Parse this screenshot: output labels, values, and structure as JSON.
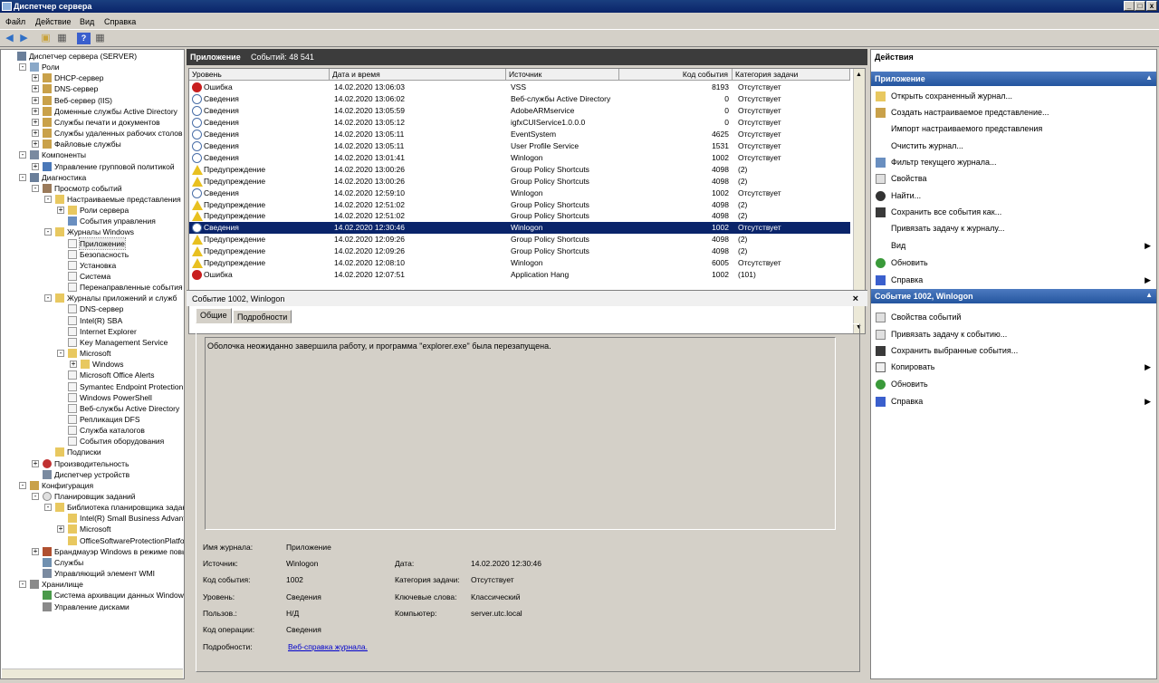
{
  "window": {
    "title": "Диспетчер сервера"
  },
  "menu": [
    "Файл",
    "Действие",
    "Вид",
    "Справка"
  ],
  "tree": [
    {
      "label": "Диспетчер сервера (SERVER)",
      "level": 0,
      "exp": "",
      "icon": "server-icon"
    },
    {
      "label": "Роли",
      "level": 1,
      "exp": "-",
      "icon": "roles-icon"
    },
    {
      "label": "DHCP-сервер",
      "level": 2,
      "exp": "+",
      "icon": "role-icon"
    },
    {
      "label": "DNS-сервер",
      "level": 2,
      "exp": "+",
      "icon": "role-icon"
    },
    {
      "label": "Веб-сервер (IIS)",
      "level": 2,
      "exp": "+",
      "icon": "role-icon"
    },
    {
      "label": "Доменные службы Active Directory",
      "level": 2,
      "exp": "+",
      "icon": "role-icon"
    },
    {
      "label": "Службы печати и документов",
      "level": 2,
      "exp": "+",
      "icon": "role-icon"
    },
    {
      "label": "Службы удаленных рабочих столов",
      "level": 2,
      "exp": "+",
      "icon": "role-icon"
    },
    {
      "label": "Файловые службы",
      "level": 2,
      "exp": "+",
      "icon": "role-icon"
    },
    {
      "label": "Компоненты",
      "level": 1,
      "exp": "-",
      "icon": "features-icon"
    },
    {
      "label": "Управление групповой политикой",
      "level": 2,
      "exp": "+",
      "icon": "gpo-icon"
    },
    {
      "label": "Диагностика",
      "level": 1,
      "exp": "-",
      "icon": "diagnostics-icon"
    },
    {
      "label": "Просмотр событий",
      "level": 2,
      "exp": "-",
      "icon": "event-viewer-icon"
    },
    {
      "label": "Настраиваемые представления",
      "level": 3,
      "exp": "-",
      "icon": "folder-icon"
    },
    {
      "label": "Роли сервера",
      "level": 4,
      "exp": "+",
      "icon": "folder-icon"
    },
    {
      "label": "События управления",
      "level": 4,
      "exp": "",
      "icon": "filter-icon"
    },
    {
      "label": "Журналы Windows",
      "level": 3,
      "exp": "-",
      "icon": "folder-icon"
    },
    {
      "label": "Приложение",
      "level": 4,
      "exp": "",
      "icon": "log-icon",
      "selected": true
    },
    {
      "label": "Безопасность",
      "level": 4,
      "exp": "",
      "icon": "log-icon"
    },
    {
      "label": "Установка",
      "level": 4,
      "exp": "",
      "icon": "log-icon"
    },
    {
      "label": "Система",
      "level": 4,
      "exp": "",
      "icon": "log-icon"
    },
    {
      "label": "Перенаправленные события",
      "level": 4,
      "exp": "",
      "icon": "log-icon"
    },
    {
      "label": "Журналы приложений и служб",
      "level": 3,
      "exp": "-",
      "icon": "folder-icon"
    },
    {
      "label": "DNS-сервер",
      "level": 4,
      "exp": "",
      "icon": "log-icon"
    },
    {
      "label": "Intel(R) SBA",
      "level": 4,
      "exp": "",
      "icon": "log-icon"
    },
    {
      "label": "Internet Explorer",
      "level": 4,
      "exp": "",
      "icon": "log-icon"
    },
    {
      "label": "Key Management Service",
      "level": 4,
      "exp": "",
      "icon": "log-icon"
    },
    {
      "label": "Microsoft",
      "level": 4,
      "exp": "-",
      "icon": "folder-icon"
    },
    {
      "label": "Windows",
      "level": 5,
      "exp": "+",
      "icon": "folder-icon"
    },
    {
      "label": "Microsoft Office Alerts",
      "level": 4,
      "exp": "",
      "icon": "log-icon"
    },
    {
      "label": "Symantec Endpoint Protection Clie",
      "level": 4,
      "exp": "",
      "icon": "log-icon"
    },
    {
      "label": "Windows PowerShell",
      "level": 4,
      "exp": "",
      "icon": "log-icon"
    },
    {
      "label": "Веб-службы Active Directory",
      "level": 4,
      "exp": "",
      "icon": "log-icon"
    },
    {
      "label": "Репликация DFS",
      "level": 4,
      "exp": "",
      "icon": "log-icon"
    },
    {
      "label": "Служба каталогов",
      "level": 4,
      "exp": "",
      "icon": "log-icon"
    },
    {
      "label": "События оборудования",
      "level": 4,
      "exp": "",
      "icon": "log-icon"
    },
    {
      "label": "Подписки",
      "level": 3,
      "exp": "",
      "icon": "subscriptions-icon"
    },
    {
      "label": "Производительность",
      "level": 2,
      "exp": "+",
      "icon": "performance-icon"
    },
    {
      "label": "Диспетчер устройств",
      "level": 2,
      "exp": "",
      "icon": "device-manager-icon"
    },
    {
      "label": "Конфигурация",
      "level": 1,
      "exp": "-",
      "icon": "configuration-icon"
    },
    {
      "label": "Планировщик заданий",
      "level": 2,
      "exp": "-",
      "icon": "scheduler-icon"
    },
    {
      "label": "Библиотека планировщика заданий",
      "level": 3,
      "exp": "-",
      "icon": "folder-icon"
    },
    {
      "label": "Intel(R) Small Business Advantage",
      "level": 4,
      "exp": "",
      "icon": "folder-icon"
    },
    {
      "label": "Microsoft",
      "level": 4,
      "exp": "+",
      "icon": "folder-icon"
    },
    {
      "label": "OfficeSoftwareProtectionPlatform",
      "level": 4,
      "exp": "",
      "icon": "folder-icon"
    },
    {
      "label": "Брандмауэр Windows в режиме повышен",
      "level": 2,
      "exp": "+",
      "icon": "firewall-icon"
    },
    {
      "label": "Службы",
      "level": 2,
      "exp": "",
      "icon": "services-icon"
    },
    {
      "label": "Управляющий элемент WMI",
      "level": 2,
      "exp": "",
      "icon": "wmi-icon"
    },
    {
      "label": "Хранилище",
      "level": 1,
      "exp": "-",
      "icon": "storage-icon"
    },
    {
      "label": "Система архивации данных Windows Se",
      "level": 2,
      "exp": "",
      "icon": "backup-icon"
    },
    {
      "label": "Управление дисками",
      "level": 2,
      "exp": "",
      "icon": "disk-icon"
    }
  ],
  "log": {
    "title": "Приложение",
    "count": "Событий: 48 541",
    "columns": [
      "Уровень",
      "Дата и время",
      "Источник",
      "Код события",
      "Категория задачи"
    ],
    "rows": [
      {
        "level": "Ошибка",
        "type": "error",
        "date": "14.02.2020 13:06:03",
        "source": "VSS",
        "code": "8193",
        "cat": "Отсутствует"
      },
      {
        "level": "Сведения",
        "type": "info",
        "date": "14.02.2020 13:06:02",
        "source": "Веб-службы Active Directory",
        "code": "0",
        "cat": "Отсутствует"
      },
      {
        "level": "Сведения",
        "type": "info",
        "date": "14.02.2020 13:05:59",
        "source": "AdobeARMservice",
        "code": "0",
        "cat": "Отсутствует"
      },
      {
        "level": "Сведения",
        "type": "info",
        "date": "14.02.2020 13:05:12",
        "source": "igfxCUIService1.0.0.0",
        "code": "0",
        "cat": "Отсутствует"
      },
      {
        "level": "Сведения",
        "type": "info",
        "date": "14.02.2020 13:05:11",
        "source": "EventSystem",
        "code": "4625",
        "cat": "Отсутствует"
      },
      {
        "level": "Сведения",
        "type": "info",
        "date": "14.02.2020 13:05:11",
        "source": "User Profile Service",
        "code": "1531",
        "cat": "Отсутствует"
      },
      {
        "level": "Сведения",
        "type": "info",
        "date": "14.02.2020 13:01:41",
        "source": "Winlogon",
        "code": "1002",
        "cat": "Отсутствует"
      },
      {
        "level": "Предупреждение",
        "type": "warning",
        "date": "14.02.2020 13:00:26",
        "source": "Group Policy Shortcuts",
        "code": "4098",
        "cat": "(2)"
      },
      {
        "level": "Предупреждение",
        "type": "warning",
        "date": "14.02.2020 13:00:26",
        "source": "Group Policy Shortcuts",
        "code": "4098",
        "cat": "(2)"
      },
      {
        "level": "Сведения",
        "type": "info",
        "date": "14.02.2020 12:59:10",
        "source": "Winlogon",
        "code": "1002",
        "cat": "Отсутствует"
      },
      {
        "level": "Предупреждение",
        "type": "warning",
        "date": "14.02.2020 12:51:02",
        "source": "Group Policy Shortcuts",
        "code": "4098",
        "cat": "(2)"
      },
      {
        "level": "Предупреждение",
        "type": "warning",
        "date": "14.02.2020 12:51:02",
        "source": "Group Policy Shortcuts",
        "code": "4098",
        "cat": "(2)"
      },
      {
        "level": "Сведения",
        "type": "info",
        "date": "14.02.2020 12:30:46",
        "source": "Winlogon",
        "code": "1002",
        "cat": "Отсутствует",
        "selected": true
      },
      {
        "level": "Предупреждение",
        "type": "warning",
        "date": "14.02.2020 12:09:26",
        "source": "Group Policy Shortcuts",
        "code": "4098",
        "cat": "(2)"
      },
      {
        "level": "Предупреждение",
        "type": "warning",
        "date": "14.02.2020 12:09:26",
        "source": "Group Policy Shortcuts",
        "code": "4098",
        "cat": "(2)"
      },
      {
        "level": "Предупреждение",
        "type": "warning",
        "date": "14.02.2020 12:08:10",
        "source": "Winlogon",
        "code": "6005",
        "cat": "Отсутствует"
      },
      {
        "level": "Ошибка",
        "type": "error",
        "date": "14.02.2020 12:07:51",
        "source": "Application Hang",
        "code": "1002",
        "cat": "(101)"
      }
    ]
  },
  "detail": {
    "title": "Событие 1002, Winlogon",
    "tabs": [
      "Общие",
      "Подробности"
    ],
    "message": "Оболочка неожиданно завершила работу, и программа \"explorer.exe\" была перезапущена.",
    "fields": {
      "log_label": "Имя журнала:",
      "log_value": "Приложение",
      "source_label": "Источник:",
      "source_value": "Winlogon",
      "date_label": "Дата:",
      "date_value": "14.02.2020 12:30:46",
      "code_label": "Код события:",
      "code_value": "1002",
      "task_label": "Категория задачи:",
      "task_value": "Отсутствует",
      "level_label": "Уровень:",
      "level_value": "Сведения",
      "keywords_label": "Ключевые слова:",
      "keywords_value": "Классический",
      "user_label": "Пользов.:",
      "user_value": "Н/Д",
      "computer_label": "Компьютер:",
      "computer_value": "server.utc.local",
      "opcode_label": "Код операции:",
      "opcode_value": "Сведения",
      "more_label": "Подробности:",
      "more_link": "Веб-справка журнала."
    }
  },
  "actions": {
    "title": "Действия",
    "sections": [
      {
        "title": "Приложение",
        "items": [
          {
            "label": "Открыть сохраненный журнал...",
            "icon": "open-log-icon",
            "arrow": false
          },
          {
            "label": "Создать настраиваемое представление...",
            "icon": "create-view-icon",
            "arrow": false
          },
          {
            "label": "Импорт настраиваемого представления",
            "icon": "",
            "arrow": false
          },
          {
            "label": "Очистить журнал...",
            "icon": "",
            "arrow": false
          },
          {
            "label": "Фильтр текущего журнала...",
            "icon": "filter-icon",
            "arrow": false
          },
          {
            "label": "Свойства",
            "icon": "properties-icon",
            "arrow": false
          },
          {
            "label": "Найти...",
            "icon": "find-icon",
            "arrow": false
          },
          {
            "label": "Сохранить все события как...",
            "icon": "save-icon",
            "arrow": false
          },
          {
            "label": "Привязать задачу к журналу...",
            "icon": "",
            "arrow": false
          },
          {
            "label": "Вид",
            "icon": "",
            "arrow": true
          },
          {
            "label": "Обновить",
            "icon": "refresh-icon",
            "arrow": false
          },
          {
            "label": "Справка",
            "icon": "help-icon",
            "arrow": true
          }
        ]
      },
      {
        "title": "Событие 1002, Winlogon",
        "items": [
          {
            "label": "Свойства событий",
            "icon": "properties-icon",
            "arrow": false
          },
          {
            "label": "Привязать задачу к событию...",
            "icon": "attach-task-icon",
            "arrow": false
          },
          {
            "label": "Сохранить выбранные события...",
            "icon": "save-icon",
            "arrow": false
          },
          {
            "label": "Копировать",
            "icon": "copy-icon",
            "arrow": true
          },
          {
            "label": "Обновить",
            "icon": "refresh-icon",
            "arrow": false
          },
          {
            "label": "Справка",
            "icon": "help-icon",
            "arrow": true
          }
        ]
      }
    ]
  }
}
